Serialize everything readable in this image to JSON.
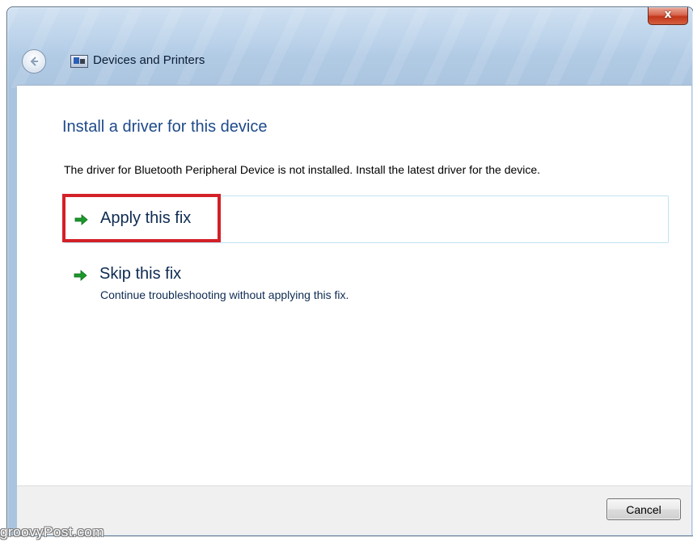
{
  "window": {
    "close_symbol": "x",
    "nav_title": "Devices and Printers",
    "icons": {
      "back": "back-arrow-icon",
      "app": "devices-and-printers-icon",
      "close": "close-icon"
    }
  },
  "content": {
    "heading": "Install a driver for this device",
    "description": "The driver for Bluetooth Peripheral Device is not installed. Install the latest driver for the device.",
    "options": [
      {
        "title": "Apply this fix",
        "subtitle": "",
        "icon": "green-arrow-icon",
        "highlighted": true
      },
      {
        "title": "Skip this fix",
        "subtitle": "Continue troubleshooting without applying this fix.",
        "icon": "green-arrow-icon",
        "highlighted": false
      }
    ]
  },
  "footer": {
    "cancel_label": "Cancel"
  },
  "watermark": "groovyPost.com",
  "colors": {
    "heading": "#1e4a8a",
    "highlight_border": "#d42027",
    "arrow_green": "#1a9a2a",
    "option_hover_border": "#bfe3f4"
  }
}
